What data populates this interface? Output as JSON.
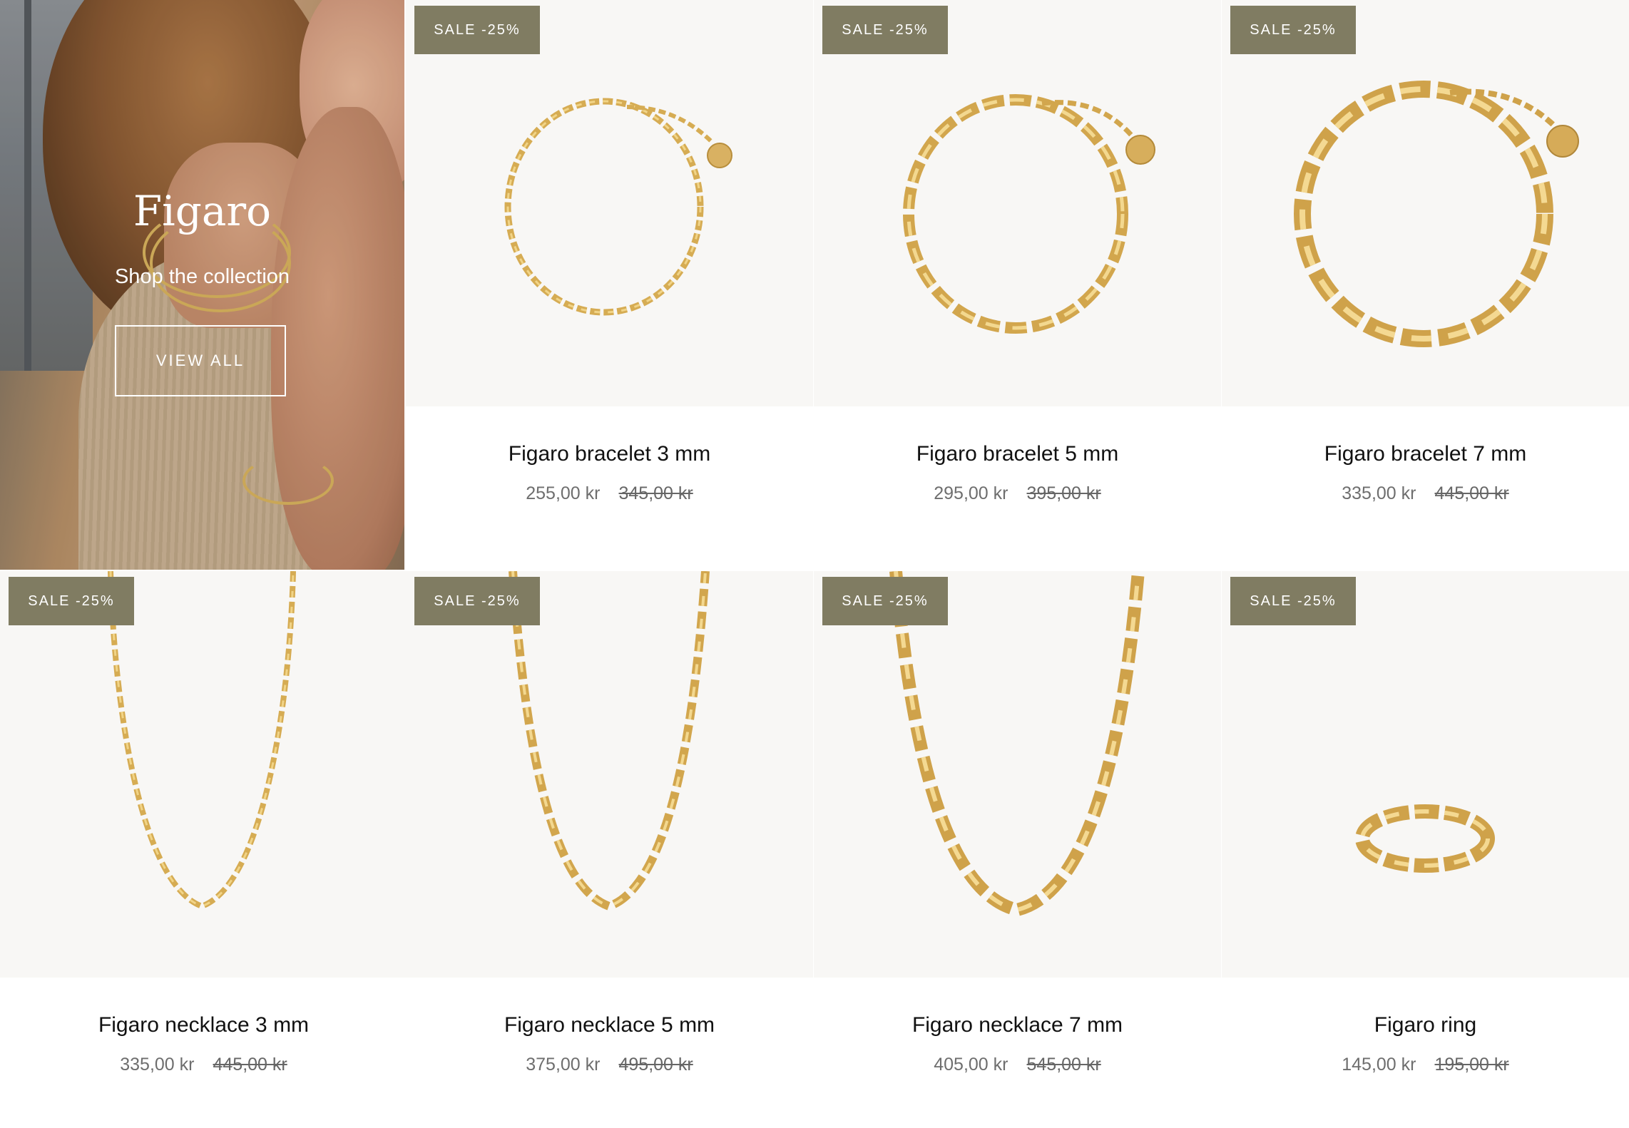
{
  "hero": {
    "title": "Figaro",
    "subtitle": "Shop the collection",
    "button_label": "VIEW ALL"
  },
  "products": [
    {
      "name": "Figaro bracelet 3 mm",
      "price": "255,00 kr",
      "old_price": "345,00 kr",
      "badge": "SALE -25%",
      "image_icon": "bracelet-thin"
    },
    {
      "name": "Figaro bracelet 5 mm",
      "price": "295,00 kr",
      "old_price": "395,00 kr",
      "badge": "SALE -25%",
      "image_icon": "bracelet-medium"
    },
    {
      "name": "Figaro bracelet 7 mm",
      "price": "335,00 kr",
      "old_price": "445,00 kr",
      "badge": "SALE -25%",
      "image_icon": "bracelet-thick"
    },
    {
      "name": "Figaro necklace 3 mm",
      "price": "335,00 kr",
      "old_price": "445,00 kr",
      "badge": "SALE -25%",
      "image_icon": "necklace-thin"
    },
    {
      "name": "Figaro necklace 5 mm",
      "price": "375,00 kr",
      "old_price": "495,00 kr",
      "badge": "SALE -25%",
      "image_icon": "necklace-medium"
    },
    {
      "name": "Figaro necklace 7 mm",
      "price": "405,00 kr",
      "old_price": "545,00 kr",
      "badge": "SALE -25%",
      "image_icon": "necklace-thick"
    },
    {
      "name": "Figaro ring",
      "price": "145,00 kr",
      "old_price": "195,00 kr",
      "badge": "SALE -25%",
      "image_icon": "ring"
    }
  ],
  "colors": {
    "badge_bg": "#807c62",
    "image_bg": "#f8f7f5",
    "gold": "#d7b25d",
    "price_text": "#6e6e6e"
  }
}
